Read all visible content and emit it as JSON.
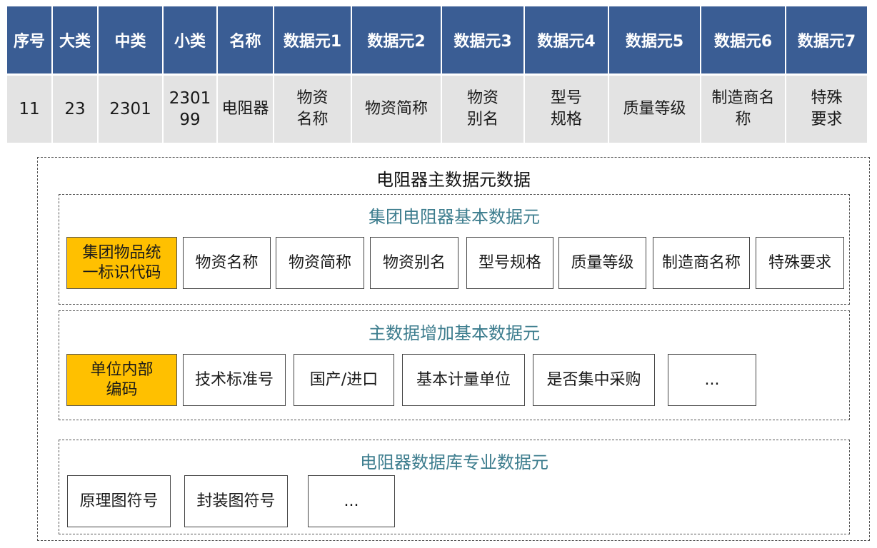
{
  "table": {
    "headers": [
      "序号",
      "大类",
      "中类",
      "小类",
      "名称",
      "数据元1",
      "数据元2",
      "数据元3",
      "数据元4",
      "数据元5",
      "数据元6",
      "数据元7"
    ],
    "row": [
      [
        "11"
      ],
      [
        "23"
      ],
      [
        "2301"
      ],
      [
        "2301",
        "99"
      ],
      [
        "电阻器"
      ],
      [
        "物资",
        "名称"
      ],
      [
        "物资简称"
      ],
      [
        "物资",
        "别名"
      ],
      [
        "型号",
        "规格"
      ],
      [
        "质量等级"
      ],
      [
        "制造商名",
        "称"
      ],
      [
        "特殊",
        "要求"
      ]
    ]
  },
  "diagram": {
    "title": "电阻器主数据元数据",
    "groups": [
      {
        "title": "集团电阻器基本数据元",
        "key_lines": [
          "集团物品统",
          "一标识代码"
        ],
        "items": [
          "物资名称",
          "物资简称",
          "物资别名",
          "型号规格",
          "质量等级",
          "制造商名称",
          "特殊要求"
        ]
      },
      {
        "title": "主数据增加基本数据元",
        "key_lines": [
          "单位内部",
          "编码"
        ],
        "items": [
          "技术标准号",
          "国产/进口",
          "基本计量单位",
          "是否集中采购",
          "..."
        ]
      },
      {
        "title": "电阻器数据库专业数据元",
        "items": [
          "原理图符号",
          "封装图符号",
          "..."
        ]
      }
    ]
  }
}
